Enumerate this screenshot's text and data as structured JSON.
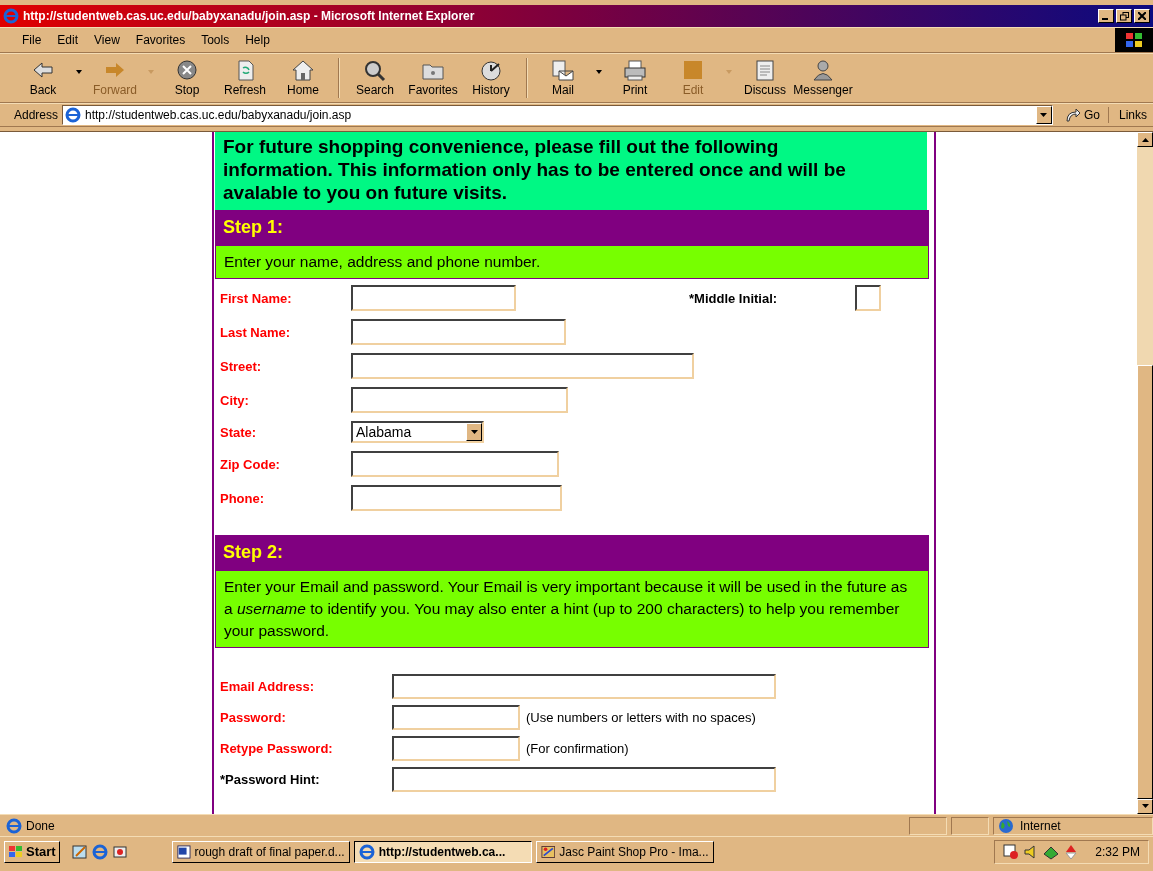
{
  "window": {
    "title": "http://studentweb.cas.uc.edu/babyxanadu/join.asp - Microsoft Internet Explorer"
  },
  "menu": [
    "File",
    "Edit",
    "View",
    "Favorites",
    "Tools",
    "Help"
  ],
  "toolbar": [
    {
      "label": "Back",
      "disabled": false,
      "dropdown": true,
      "group_end": false
    },
    {
      "label": "Forward",
      "disabled": true,
      "dropdown": true,
      "group_end": false
    },
    {
      "label": "Stop",
      "disabled": false,
      "dropdown": false,
      "group_end": false
    },
    {
      "label": "Refresh",
      "disabled": false,
      "dropdown": false,
      "group_end": false
    },
    {
      "label": "Home",
      "disabled": false,
      "dropdown": false,
      "group_end": true
    },
    {
      "label": "Search",
      "disabled": false,
      "dropdown": false,
      "group_end": false
    },
    {
      "label": "Favorites",
      "disabled": false,
      "dropdown": false,
      "group_end": false
    },
    {
      "label": "History",
      "disabled": false,
      "dropdown": false,
      "group_end": true
    },
    {
      "label": "Mail",
      "disabled": false,
      "dropdown": true,
      "group_end": false
    },
    {
      "label": "Print",
      "disabled": false,
      "dropdown": false,
      "group_end": false
    },
    {
      "label": "Edit",
      "disabled": true,
      "dropdown": true,
      "group_end": false
    },
    {
      "label": "Discuss",
      "disabled": false,
      "dropdown": false,
      "group_end": false
    },
    {
      "label": "Messenger",
      "disabled": false,
      "dropdown": false,
      "group_end": false
    }
  ],
  "address_bar": {
    "label": "Address",
    "url": "http://studentweb.cas.uc.edu/babyxanadu/join.asp",
    "go": "Go",
    "links": "Links"
  },
  "page": {
    "intro": "For future shopping convenience, please fill out the following information.  This information only has to be entered once and will be avalable to you on future visits.",
    "steps": [
      {
        "title": "Step 1:",
        "text": "Enter your name, address and phone number.",
        "fields": [
          {
            "label": "First Name:",
            "required": true,
            "kind": "text"
          },
          {
            "label": "*Middle Initial:",
            "required": false,
            "kind": "text"
          },
          {
            "label": "Last Name:",
            "required": true,
            "kind": "text"
          },
          {
            "label": "Street:",
            "required": true,
            "kind": "text"
          },
          {
            "label": "City:",
            "required": true,
            "kind": "text"
          },
          {
            "label": "State:",
            "required": true,
            "kind": "select",
            "value": "Alabama"
          },
          {
            "label": "Zip Code:",
            "required": true,
            "kind": "text"
          },
          {
            "label": "Phone:",
            "required": true,
            "kind": "text"
          }
        ]
      },
      {
        "title": "Step 2:",
        "text": "Enter your Email and password.  Your Email is very important because it will be used in the future as a *username* to identify you.  You may also enter a hint (up to 200 characters) to help you remember your password.",
        "fields": [
          {
            "label": "Email Address:",
            "required": true,
            "kind": "text"
          },
          {
            "label": "Password:",
            "required": true,
            "kind": "text",
            "note": "(Use numbers or letters with no spaces)"
          },
          {
            "label": "Retype Password:",
            "required": true,
            "kind": "text",
            "note": "(For confirmation)"
          },
          {
            "label": "*Password Hint:",
            "required": false,
            "kind": "text"
          }
        ]
      }
    ]
  },
  "status_bar": {
    "text": "Done",
    "zone": "Internet"
  },
  "taskbar": {
    "start": "Start",
    "tasks": [
      {
        "label": "rough draft of final paper.d...",
        "selected": false
      },
      {
        "label": "http://studentweb.ca...",
        "selected": true
      },
      {
        "label": "Jasc Paint Shop Pro - Ima...",
        "selected": false
      }
    ],
    "clock": "2:32 PM"
  }
}
